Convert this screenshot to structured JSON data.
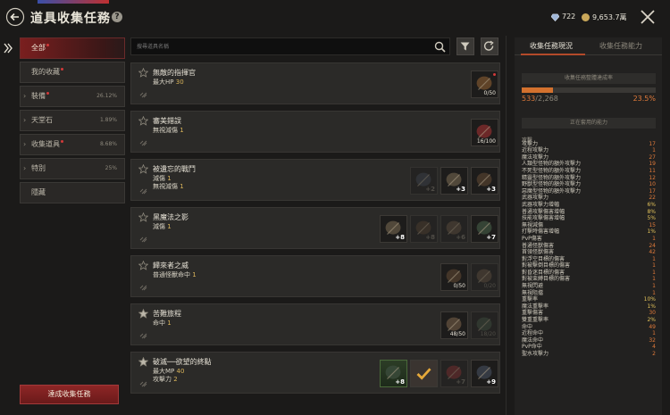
{
  "header": {
    "title": "道具收集任務",
    "help": "?",
    "gems": "722",
    "coins": "9,653.7萬"
  },
  "sidebar": {
    "items": [
      {
        "label": "全部",
        "pct": "",
        "chev": "",
        "dot": true
      },
      {
        "label": "我的收藏",
        "pct": "",
        "chev": "",
        "dot": true
      },
      {
        "label": "裝備",
        "pct": "26.12%",
        "chev": "›",
        "dot": true
      },
      {
        "label": "天堂石",
        "pct": "1.89%",
        "chev": "›",
        "dot": false
      },
      {
        "label": "收集道具",
        "pct": "8.68%",
        "chev": "›",
        "dot": true
      },
      {
        "label": "特別",
        "pct": "25%",
        "chev": "›",
        "dot": false
      },
      {
        "label": "隱藏",
        "pct": "",
        "chev": "",
        "dot": false
      }
    ],
    "action_button": "達成收集任務"
  },
  "search": {
    "placeholder": "搜尋道具名稱"
  },
  "tasks": [
    {
      "name": "無敵的指揮官",
      "stats": [
        {
          "label": "最大HP",
          "value": "30"
        }
      ],
      "slots": [
        {
          "count": "0/50",
          "dot": true
        }
      ]
    },
    {
      "name": "審美錯誤",
      "stats": [
        {
          "label": "無視減傷",
          "value": "1"
        }
      ],
      "slots": [
        {
          "count": "16/100",
          "dot": false
        }
      ]
    },
    {
      "name": "被遺忘的戰鬥",
      "stats": [
        {
          "label": "減傷",
          "value": "1"
        },
        {
          "label": "無視減傷",
          "value": "1"
        }
      ],
      "slots": [
        {
          "plus": "+2",
          "dim": true
        },
        {
          "plus": "+3"
        },
        {
          "plus": "+3"
        }
      ]
    },
    {
      "name": "黑魔法之影",
      "stats": [
        {
          "label": "減傷",
          "value": "1"
        }
      ],
      "slots": [
        {
          "plus": "+8"
        },
        {
          "plus": "+8",
          "dim": true
        },
        {
          "plus": "+6",
          "dim": true
        },
        {
          "plus": "+7"
        }
      ]
    },
    {
      "name": "歸來者之威",
      "stats": [
        {
          "label": "普通怪獸命中",
          "value": "1"
        }
      ],
      "slots": [
        {
          "count": "0/50"
        },
        {
          "count": "0/20",
          "dim": true
        }
      ]
    },
    {
      "name": "苦難旅程",
      "stats": [
        {
          "label": "命中",
          "value": "1"
        }
      ],
      "slots": [
        {
          "count": "48/50"
        },
        {
          "count": "18/20",
          "dim": true
        }
      ]
    },
    {
      "name": "破滅──欲望的終點",
      "stats": [
        {
          "label": "最大MP",
          "value": "40"
        },
        {
          "label": "攻擊力",
          "value": "2"
        }
      ],
      "slots": [
        {
          "plus": "+8"
        },
        {
          "plus": ""
        },
        {
          "plus": "+7",
          "dim": true
        },
        {
          "plus": "+9"
        }
      ]
    }
  ],
  "right_panel": {
    "tabs": [
      "收集任務現況",
      "收集任務能力"
    ],
    "rate_title": "收集任務整體達成率",
    "progress": {
      "current": "533",
      "total": "/2,268",
      "percent": "23.5%",
      "fraction": 0.235
    },
    "ability_title": "正在套用的能力",
    "stats": [
      {
        "label": "攻擊",
        "value": "",
        "header": true
      },
      {
        "label": "攻擊力",
        "value": "17"
      },
      {
        "label": "近程攻擊力",
        "value": "1"
      },
      {
        "label": "魔法攻擊力",
        "value": "27"
      },
      {
        "label": "人類型怪物的額外攻擊力",
        "value": "19"
      },
      {
        "label": "不死型怪物的額外攻擊力",
        "value": "11"
      },
      {
        "label": "精靈型怪物的額外攻擊力",
        "value": "12"
      },
      {
        "label": "野獸型怪物的額外攻擊力",
        "value": "10"
      },
      {
        "label": "惡魔型怪物的額外攻擊力",
        "value": "17"
      },
      {
        "label": "武器攻擊力",
        "value": "22"
      },
      {
        "label": "武器攻擊力增幅",
        "value": "6%",
        "y": true
      },
      {
        "label": "普通攻擊傷害增幅",
        "value": "8%",
        "y": true
      },
      {
        "label": "技能攻擊傷害增幅",
        "value": "5%",
        "y": true
      },
      {
        "label": "無視減傷",
        "value": "15"
      },
      {
        "label": "打擊時傷害增幅",
        "value": "1%",
        "y": true
      },
      {
        "label": "PvP傷害",
        "value": "1"
      },
      {
        "label": "普通怪獸傷害",
        "value": "24"
      },
      {
        "label": "首領怪獸傷害",
        "value": "42"
      },
      {
        "label": "對浮空目標的傷害",
        "value": "1"
      },
      {
        "label": "對被擊倒目標的傷害",
        "value": "1"
      },
      {
        "label": "對昏迷目標的傷害",
        "value": "1"
      },
      {
        "label": "對被束縛目標的傷害",
        "value": "1"
      },
      {
        "label": "無視閃避",
        "value": "1"
      },
      {
        "label": "無視阻擋",
        "value": "1"
      },
      {
        "label": "重擊率",
        "value": "10%",
        "y": true
      },
      {
        "label": "魔法重擊率",
        "value": "1%",
        "y": true
      },
      {
        "label": "重擊傷害",
        "value": "30"
      },
      {
        "label": "雙重重擊率",
        "value": "2%",
        "y": true
      },
      {
        "label": "命中",
        "value": "49"
      },
      {
        "label": "近程命中",
        "value": "1"
      },
      {
        "label": "魔法命中",
        "value": "32"
      },
      {
        "label": "PvP命中",
        "value": "4"
      },
      {
        "label": "聖水攻擊力",
        "value": "2"
      }
    ]
  }
}
